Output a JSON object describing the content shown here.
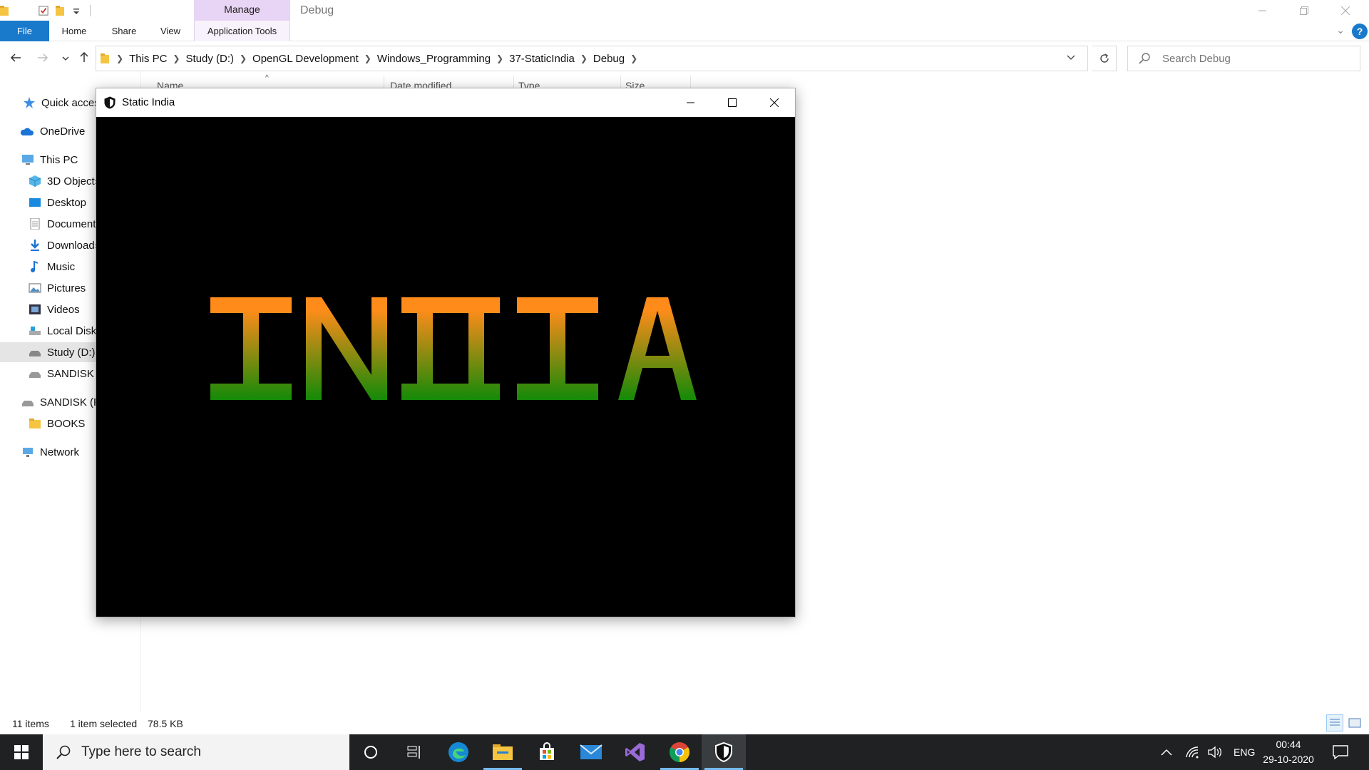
{
  "explorer": {
    "title": "Debug",
    "manage_label": "Manage",
    "tabs": {
      "file": "File",
      "home": "Home",
      "share": "Share",
      "view": "View",
      "application_tools": "Application Tools"
    },
    "breadcrumb": [
      "This PC",
      "Study (D:)",
      "OpenGL Development",
      "Windows_Programming",
      "37-StaticIndia",
      "Debug"
    ],
    "search_placeholder": "Search Debug",
    "columns": {
      "name": "Name",
      "date_modified": "Date modified",
      "type": "Type",
      "size": "Size"
    },
    "nav": {
      "quick_access": "Quick access",
      "onedrive": "OneDrive",
      "this_pc": "This PC",
      "objects_3d": "3D Objects",
      "desktop": "Desktop",
      "documents": "Documents",
      "downloads": "Downloads",
      "music": "Music",
      "pictures": "Pictures",
      "videos": "Videos",
      "local_disk": "Local Disk (C:)",
      "study": "Study (D:)",
      "sandisk_sub": "SANDISK (F:)",
      "sandisk": "SANDISK (F:)",
      "books": "BOOKS",
      "network": "Network"
    },
    "status": {
      "items": "11 items",
      "selected": "1 item selected",
      "size": "78.5 KB"
    }
  },
  "app_window": {
    "title": "Static India",
    "canvas_text": "INDIA",
    "colors": {
      "saffron": "#ff8c1a",
      "green": "#138a08",
      "background": "#000000"
    }
  },
  "taskbar": {
    "search_placeholder": "Type here to search",
    "apps": [
      "cortana-icon",
      "task-view-icon",
      "edge-icon",
      "file-explorer-icon",
      "store-icon",
      "mail-icon",
      "visual-studio-icon",
      "chrome-icon",
      "static-india-app-icon"
    ],
    "language": "ENG",
    "time": "00:44",
    "date": "29-10-2020"
  }
}
